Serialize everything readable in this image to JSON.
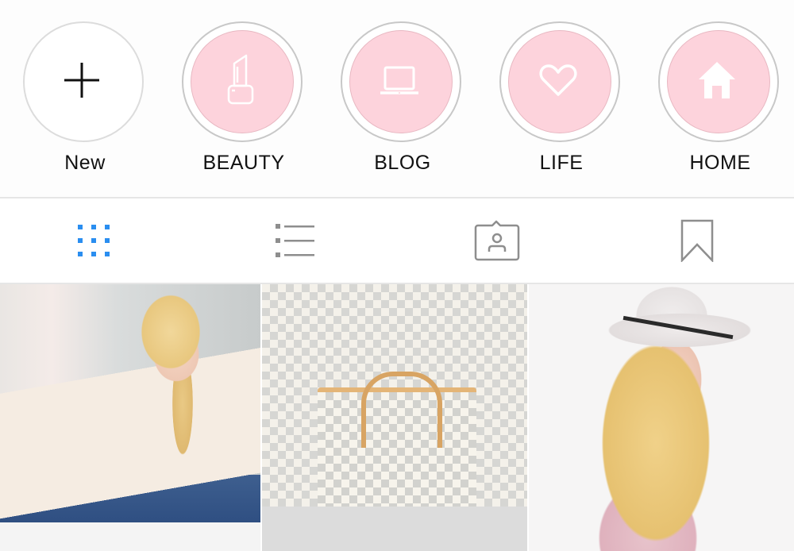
{
  "highlights": [
    {
      "label": "New",
      "icon": "plus-icon",
      "type": "new"
    },
    {
      "label": "BEAUTY",
      "icon": "lipstick-icon",
      "type": "highlight"
    },
    {
      "label": "BLOG",
      "icon": "laptop-icon",
      "type": "highlight"
    },
    {
      "label": "LIFE",
      "icon": "heart-icon",
      "type": "highlight"
    },
    {
      "label": "HOME",
      "icon": "house-icon",
      "type": "highlight"
    }
  ],
  "colors": {
    "highlight_fill": "#fdd3dc",
    "highlight_ring": "#c8c8c8",
    "active_tab": "#2a8ef0",
    "inactive_tab": "#8e8e8e"
  },
  "tabs": [
    {
      "name": "grid-view",
      "icon": "grid-icon",
      "active": true
    },
    {
      "name": "list-view",
      "icon": "list-icon",
      "active": false
    },
    {
      "name": "tagged",
      "icon": "tagged-person-icon",
      "active": false
    },
    {
      "name": "saved",
      "icon": "bookmark-icon",
      "active": false
    }
  ],
  "posts": [
    {
      "description": "Woman in cream sweater typing on laptop in closet"
    },
    {
      "description": "Checkered tote bag on clear acrylic chair"
    },
    {
      "description": "Woman with white wide-brim hat and floral blouse"
    }
  ]
}
